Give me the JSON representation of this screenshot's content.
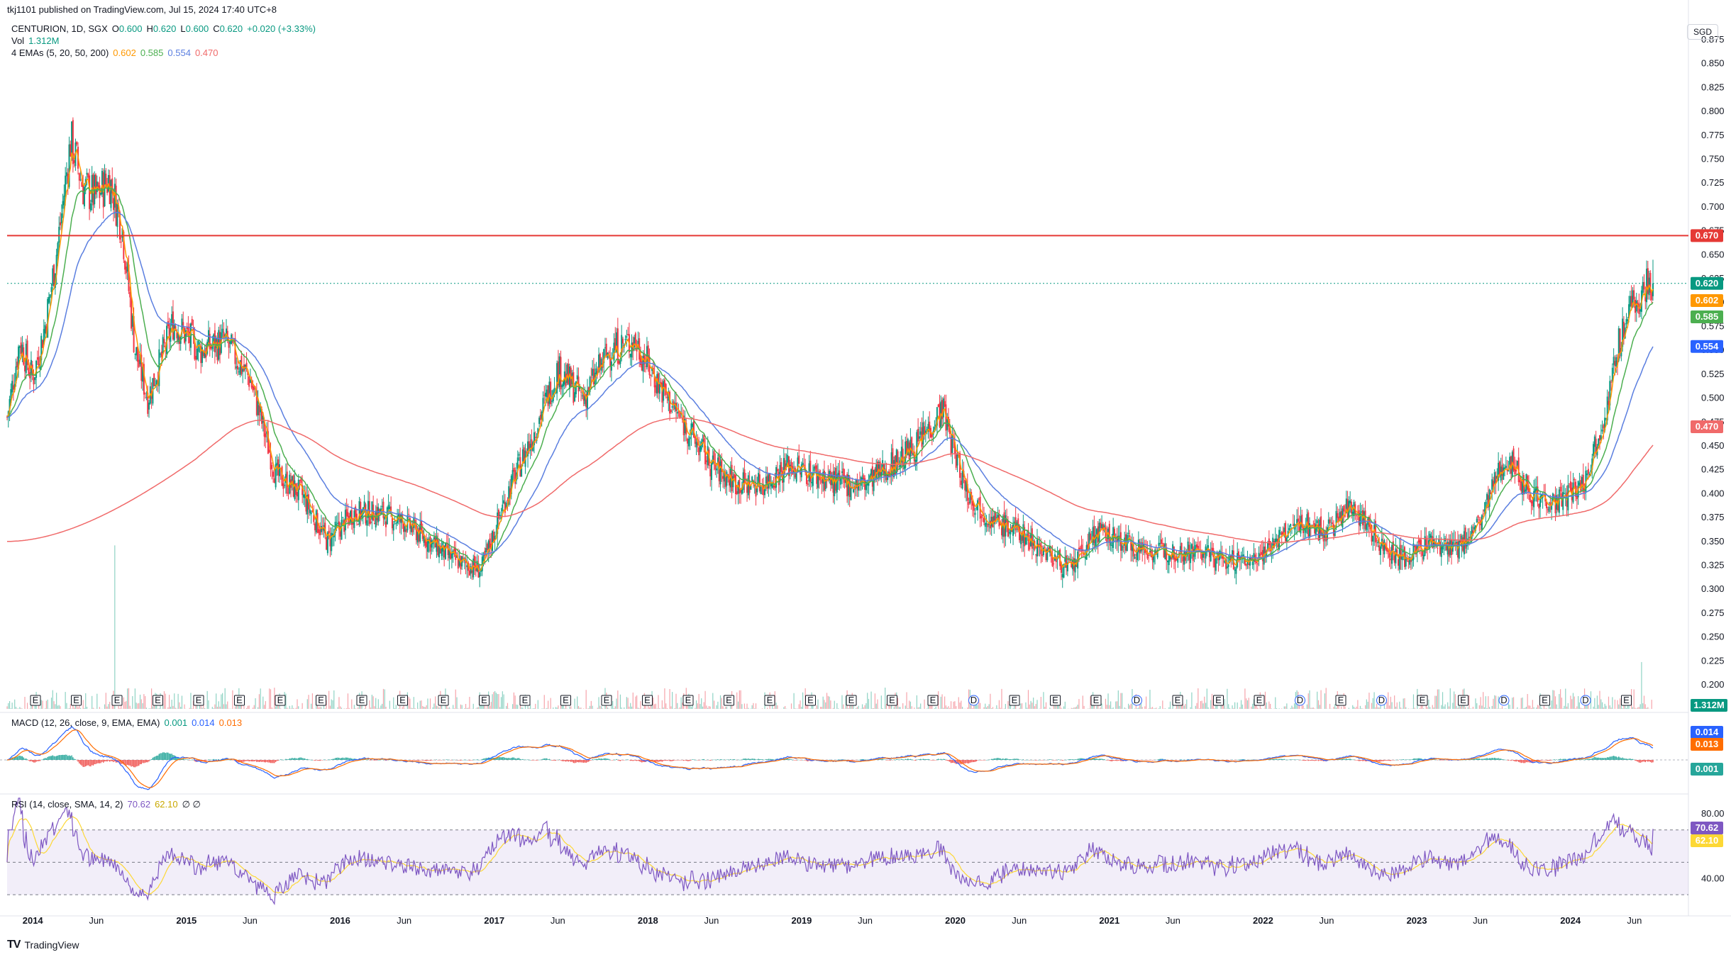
{
  "header": {
    "published": "tkj1101 published on TradingView.com, Jul 15, 2024 17:40 UTC+8",
    "symbol": "CENTURION, 1D, SGX",
    "ohlc": {
      "o_label": "O",
      "o": "0.600",
      "h_label": "H",
      "h": "0.620",
      "l_label": "L",
      "l": "0.600",
      "c_label": "C",
      "c": "0.620",
      "chg": "+0.020 (+3.33%)"
    },
    "vol_label": "Vol",
    "vol": "1.312M",
    "ema_label": "4 EMAs (5, 20, 50, 200)",
    "ema_values": [
      "0.602",
      "0.585",
      "0.554",
      "0.470"
    ],
    "macd_label": "MACD (12, 26, close, 9, EMA, EMA)",
    "macd_values": [
      "0.001",
      "0.014",
      "0.013"
    ],
    "rsi_label": "RSI (14, close, SMA, 14, 2)",
    "rsi_values": [
      "70.62",
      "62.10"
    ],
    "rsi_extra": "∅ ∅"
  },
  "currency": "SGD",
  "footer": {
    "logo": "TV",
    "brand": "TradingView"
  },
  "colors": {
    "up": "#089981",
    "down": "#f23645",
    "ema5": "#ff9800",
    "ema20": "#4caf50",
    "ema50": "#5b7fe0",
    "ema200": "#f06a6a",
    "resistance": "#e53935",
    "macd": "#2962ff",
    "signal": "#ff6d00",
    "rsi": "#7e57c2",
    "rsi_ma": "#fdd835"
  },
  "chart_data": {
    "type": "candlestick",
    "price_axis": {
      "min": 0.2,
      "max": 0.875,
      "ticks": [
        "0.200",
        "0.225",
        "0.250",
        "0.275",
        "0.300",
        "0.325",
        "0.350",
        "0.375",
        "0.400",
        "0.425",
        "0.450",
        "0.475",
        "0.500",
        "0.525",
        "0.550",
        "0.575",
        "0.600",
        "0.625",
        "0.650",
        "0.675",
        "0.700",
        "0.725",
        "0.750",
        "0.775",
        "0.800",
        "0.825",
        "0.850",
        "0.875"
      ]
    },
    "time_axis": {
      "labels": [
        "2014",
        "Jun",
        "2015",
        "Jun",
        "2016",
        "Jun",
        "2017",
        "Jun",
        "2018",
        "Jun",
        "2019",
        "Jun",
        "2020",
        "Jun",
        "2021",
        "Jun",
        "2022",
        "Jun",
        "2023",
        "Jun",
        "2024",
        "Jun"
      ]
    },
    "price_path": [
      [
        "2013-11",
        0.48
      ],
      [
        "2013-12",
        0.56
      ],
      [
        "2014-01",
        0.52
      ],
      [
        "2014-02",
        0.58
      ],
      [
        "2014-03",
        0.66
      ],
      [
        "2014-04",
        0.77
      ],
      [
        "2014-05",
        0.72
      ],
      [
        "2014-06",
        0.71
      ],
      [
        "2014-07",
        0.73
      ],
      [
        "2014-08",
        0.68
      ],
      [
        "2014-09",
        0.55
      ],
      [
        "2014-10",
        0.5
      ],
      [
        "2014-11",
        0.54
      ],
      [
        "2014-12",
        0.58
      ],
      [
        "2015-02",
        0.55
      ],
      [
        "2015-04",
        0.56
      ],
      [
        "2015-06",
        0.52
      ],
      [
        "2015-08",
        0.42
      ],
      [
        "2015-10",
        0.4
      ],
      [
        "2015-12",
        0.35
      ],
      [
        "2016-02",
        0.38
      ],
      [
        "2016-04",
        0.38
      ],
      [
        "2016-06",
        0.37
      ],
      [
        "2016-08",
        0.35
      ],
      [
        "2016-10",
        0.33
      ],
      [
        "2016-12",
        0.32
      ],
      [
        "2017-02",
        0.4
      ],
      [
        "2017-04",
        0.46
      ],
      [
        "2017-06",
        0.53
      ],
      [
        "2017-08",
        0.5
      ],
      [
        "2017-10",
        0.55
      ],
      [
        "2017-12",
        0.56
      ],
      [
        "2018-02",
        0.51
      ],
      [
        "2018-04",
        0.47
      ],
      [
        "2018-06",
        0.43
      ],
      [
        "2018-08",
        0.41
      ],
      [
        "2018-10",
        0.41
      ],
      [
        "2018-12",
        0.43
      ],
      [
        "2019-02",
        0.42
      ],
      [
        "2019-04",
        0.41
      ],
      [
        "2019-06",
        0.41
      ],
      [
        "2019-08",
        0.43
      ],
      [
        "2019-10",
        0.45
      ],
      [
        "2019-12",
        0.49
      ],
      [
        "2020-01",
        0.44
      ],
      [
        "2020-02",
        0.4
      ],
      [
        "2020-04",
        0.37
      ],
      [
        "2020-06",
        0.36
      ],
      [
        "2020-08",
        0.34
      ],
      [
        "2020-10",
        0.32
      ],
      [
        "2020-12",
        0.36
      ],
      [
        "2021-02",
        0.35
      ],
      [
        "2021-04",
        0.34
      ],
      [
        "2021-06",
        0.34
      ],
      [
        "2021-08",
        0.34
      ],
      [
        "2021-10",
        0.33
      ],
      [
        "2021-12",
        0.33
      ],
      [
        "2022-02",
        0.35
      ],
      [
        "2022-04",
        0.37
      ],
      [
        "2022-06",
        0.36
      ],
      [
        "2022-08",
        0.39
      ],
      [
        "2022-10",
        0.35
      ],
      [
        "2022-12",
        0.33
      ],
      [
        "2023-02",
        0.35
      ],
      [
        "2023-04",
        0.34
      ],
      [
        "2023-06",
        0.37
      ],
      [
        "2023-08",
        0.44
      ],
      [
        "2023-10",
        0.4
      ],
      [
        "2023-12",
        0.39
      ],
      [
        "2024-02",
        0.41
      ],
      [
        "2024-04",
        0.5
      ],
      [
        "2024-05",
        0.57
      ],
      [
        "2024-06",
        0.6
      ],
      [
        "2024-07",
        0.62
      ]
    ],
    "ema_last": {
      "ema5": 0.602,
      "ema20": 0.585,
      "ema50": 0.554,
      "ema200": 0.47
    },
    "resistance_level": {
      "value": 0.67,
      "label": "0.670"
    },
    "last_price": {
      "value": 0.62,
      "label": "0.620"
    },
    "volume_last": "1.312M",
    "macd_last": {
      "macd": 0.014,
      "signal": 0.013,
      "hist": 0.001
    },
    "rsi_levels": {
      "upper": 70,
      "middle": 50,
      "lower": 30,
      "tick_labels": [
        "80.00",
        "40.00"
      ]
    },
    "rsi_last": {
      "rsi": 70.62,
      "ma": 62.1
    },
    "event_markers": [
      "E",
      "E",
      "E",
      "E",
      "E",
      "E",
      "E",
      "E",
      "E",
      "E",
      "E",
      "E",
      "E",
      "E",
      "E",
      "E",
      "E",
      "E",
      "E",
      "E",
      "E",
      "E",
      "E",
      "D",
      "E",
      "E",
      "E",
      "D",
      "E",
      "E",
      "E",
      "D",
      "E",
      "D",
      "E",
      "E",
      "D",
      "E",
      "D",
      "E"
    ]
  }
}
